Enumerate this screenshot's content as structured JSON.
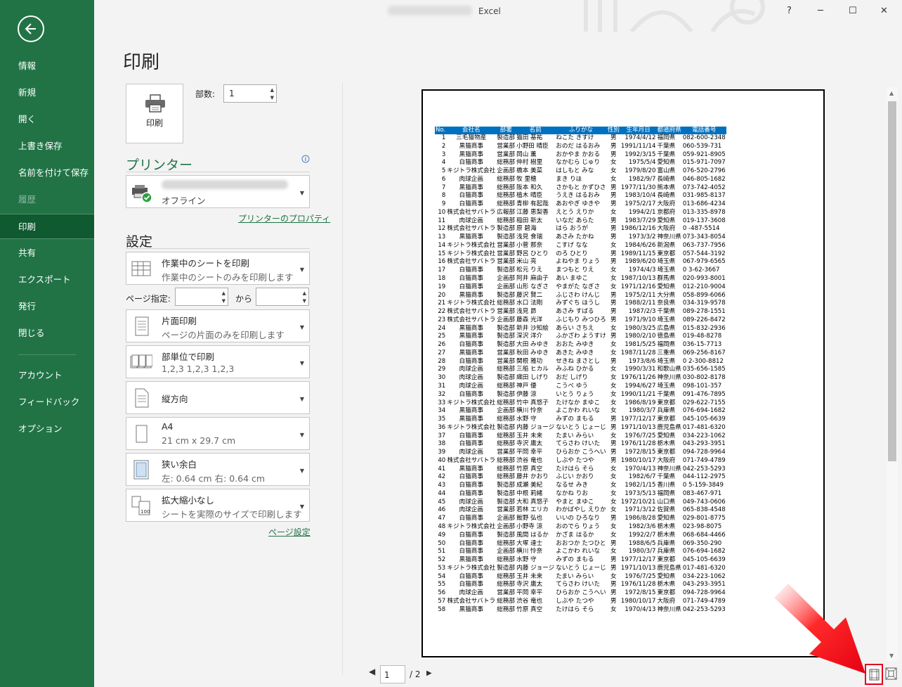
{
  "window": {
    "app_name": "Excel",
    "help": "?",
    "minimize": "─",
    "maximize": "☐",
    "close": "✕"
  },
  "sidebar": {
    "items": [
      {
        "label": "情報"
      },
      {
        "label": "新規"
      },
      {
        "label": "開く"
      },
      {
        "label": "上書き保存"
      },
      {
        "label": "名前を付けて保存"
      },
      {
        "label": "履歴"
      },
      {
        "label": "印刷"
      },
      {
        "label": "共有"
      },
      {
        "label": "エクスポート"
      },
      {
        "label": "発行"
      },
      {
        "label": "閉じる"
      }
    ],
    "bottom_items": [
      {
        "label": "アカウント"
      },
      {
        "label": "フィードバック"
      },
      {
        "label": "オプション"
      }
    ]
  },
  "print": {
    "title": "印刷",
    "print_button": "印刷",
    "copies_label": "部数:",
    "copies_value": "1",
    "printer_heading": "プリンター",
    "printer_status": "オフライン",
    "printer_properties": "プリンターのプロパティ",
    "settings_heading": "設定",
    "pages_label": "ページ指定:",
    "pages_to": "から",
    "page_setup": "ページ設定",
    "settings": [
      {
        "t1": "作業中のシートを印刷",
        "t2": "作業中のシートのみを印刷します"
      },
      {
        "t1": "片面印刷",
        "t2": "ページの片面のみを印刷します"
      },
      {
        "t1": "部単位で印刷",
        "t2": "1,2,3    1,2,3    1,2,3"
      },
      {
        "t1": "縦方向",
        "t2": ""
      },
      {
        "t1": "A4",
        "t2": "21 cm x 29.7 cm"
      },
      {
        "t1": "狭い余白",
        "t2": "左:  0.64 cm    右:  0.64 cm"
      },
      {
        "t1": "拡大縮小なし",
        "t2": "シートを実際のサイズで印刷します"
      }
    ]
  },
  "preview": {
    "page_current": "1",
    "page_total": "/ 2",
    "headers": [
      "No.",
      "会社名",
      "部署",
      "名前",
      "ふりがな",
      "性別",
      "生年月日",
      "都道府県",
      "電話番号"
    ],
    "rows": [
      [
        "1",
        "三毛猫物産",
        "製造部",
        "猫田 基祐",
        "ねこた きすけ",
        "男",
        "1974/4/12",
        "福岡県",
        "082-600-2348"
      ],
      [
        "2",
        "黒猫商事",
        "営業部",
        "小野田 晴臣",
        "おのだ はるおみ",
        "男",
        "1991/11/14",
        "千葉県",
        "060-539-731"
      ],
      [
        "3",
        "黒猫商事",
        "営業部",
        "岡山 薫",
        "おかやま かおる",
        "男",
        "1992/3/15",
        "千葉県",
        "059-921-8905"
      ],
      [
        "4",
        "白猫商事",
        "総務部",
        "仲村 樹里",
        "なかむら じゅり",
        "女",
        "1975/5/4",
        "愛知県",
        "015-971-7097"
      ],
      [
        "5",
        "キジトラ株式会社",
        "企画部",
        "橋本 美菜",
        "はしもと みな",
        "女",
        "1979/8/20",
        "富山県",
        "076-520-2796"
      ],
      [
        "6",
        "肉球企画",
        "総務部",
        "牧 里穂",
        "まき りほ",
        "女",
        "1982/9/7",
        "長崎県",
        "046-805-1682"
      ],
      [
        "7",
        "黒猫商事",
        "総務部",
        "阪本 和久",
        "さかもと かずひさ",
        "男",
        "1977/11/30",
        "熊本県",
        "073-742-4052"
      ],
      [
        "8",
        "白猫商事",
        "総務部",
        "植木 晴臣",
        "うえき はるおみ",
        "男",
        "1983/10/4",
        "長崎県",
        "031-985-8137"
      ],
      [
        "9",
        "白猫商事",
        "総務部",
        "青柳 有起哉",
        "あおやぎ ゆきや",
        "男",
        "1975/2/17",
        "大阪府",
        "013-686-4234"
      ],
      [
        "10",
        "株式会社サバトラ",
        "広報部",
        "江藤 恵梨香",
        "えとう えりか",
        "女",
        "1994/2/1",
        "京都府",
        "013-335-8978"
      ],
      [
        "11",
        "肉球企画",
        "総務部",
        "稲田 新太",
        "いなだ あらた",
        "男",
        "1983/7/29",
        "愛知県",
        "019-137-3608"
      ],
      [
        "12",
        "株式会社サバトラ",
        "製造部",
        "原 碧海",
        "はら おうが",
        "男",
        "1986/12/16",
        "大阪府",
        "0 -487-5514"
      ],
      [
        "13",
        "黒猫商事",
        "製造部",
        "浅見 食瑞",
        "あさみ たかね",
        "男",
        "1973/3/2",
        "神奈川県",
        "073-343-8054"
      ],
      [
        "14",
        "キジトラ株式会社",
        "営業部",
        "小菅 那奈",
        "こすげ なな",
        "女",
        "1984/6/26",
        "新潟県",
        "063-737-7956"
      ],
      [
        "15",
        "キジトラ株式会社",
        "営業部",
        "野呂 ひとり",
        "のろ ひとり",
        "男",
        "1989/11/15",
        "東京都",
        "057-544-3192"
      ],
      [
        "16",
        "株式会社サバトラ",
        "営業部",
        "米山 亮",
        "よねやま りょう",
        "男",
        "1989/6/20",
        "埼玉県",
        "067-979-6565"
      ],
      [
        "17",
        "白猫商事",
        "製造部",
        "松元 りえ",
        "まつもと りえ",
        "女",
        "1974/4/3",
        "埼玉県",
        "0 3-62-3667"
      ],
      [
        "18",
        "白猫商事",
        "企画部",
        "阿井 麻由子",
        "あい まゆこ",
        "女",
        "1987/10/13",
        "群馬県",
        "020-993-8001"
      ],
      [
        "19",
        "白猫商事",
        "企画部",
        "山形 なぎさ",
        "やまがた なぎさ",
        "女",
        "1971/12/16",
        "愛知県",
        "012-210-9004"
      ],
      [
        "20",
        "黒猫商事",
        "製造部",
        "藤沢 賢二",
        "ふじさわ けんじ",
        "男",
        "1975/2/11",
        "大分県",
        "058-899-6066"
      ],
      [
        "21",
        "キジトラ株式会社",
        "総務部",
        "水口 法剛",
        "みずぐち ほうし",
        "男",
        "1988/2/11",
        "奈良県",
        "034-319-9578"
      ],
      [
        "22",
        "株式会社サバトラ",
        "営業部",
        "浅見 昴",
        "あさみ すばる",
        "男",
        "1987/2/3",
        "千葉県",
        "089-278-1551"
      ],
      [
        "23",
        "株式会社サバトラ",
        "企画部",
        "藤森 光洋",
        "ふじもり みつひろ",
        "男",
        "1971/9/10",
        "埼玉県",
        "089-226-8472"
      ],
      [
        "24",
        "黒猫商事",
        "製造部",
        "新井 沙知絵",
        "あらい さちえ",
        "女",
        "1980/3/25",
        "広島県",
        "015-832-2936"
      ],
      [
        "25",
        "黒猫商事",
        "製造部",
        "深沢 洋介",
        "ふかざわ ようすけ",
        "男",
        "1980/2/10",
        "徳島県",
        "019-48-8278"
      ],
      [
        "26",
        "白猫商事",
        "製造部",
        "大田 みゆき",
        "おおた みゆき",
        "女",
        "1981/5/25",
        "福岡県",
        "036-15-7713"
      ],
      [
        "27",
        "黒猫商事",
        "営業部",
        "秋田 みゆき",
        "あきた みゆき",
        "女",
        "1987/11/28",
        "三重県",
        "069-256-8167"
      ],
      [
        "28",
        "白猫商事",
        "営業部",
        "関根 雅功",
        "せきね まさとし",
        "男",
        "1973/8/6",
        "埼玉県",
        "0 2-300-8812"
      ],
      [
        "29",
        "肉球企画",
        "総務部",
        "三船 ヒカル",
        "みふね ひかる",
        "女",
        "1990/3/31",
        "和歌山県",
        "035-656-1585"
      ],
      [
        "30",
        "肉球企画",
        "製造部",
        "織田 しげり",
        "おだ しげり",
        "女",
        "1976/11/26",
        "神奈川県",
        "030-802-8178"
      ],
      [
        "31",
        "肉球企画",
        "総務部",
        "神戸 優",
        "こうべ ゆう",
        "女",
        "1994/6/27",
        "埼玉県",
        "098-101-357"
      ],
      [
        "32",
        "白猫商事",
        "製造部",
        "伊藤 涼",
        "いとう りょう",
        "女",
        "1990/11/21",
        "千葉県",
        "091-476-7895"
      ],
      [
        "33",
        "キジトラ株式会社",
        "総務部",
        "竹中 真悠子",
        "たけなか まゆこ",
        "女",
        "1986/8/19",
        "東京都",
        "029-622-7155"
      ],
      [
        "34",
        "黒猫商事",
        "企画部",
        "横川 怜奈",
        "よこかわ れいな",
        "女",
        "1980/3/7",
        "兵庫県",
        "076-694-1682"
      ],
      [
        "35",
        "黒猫商事",
        "総務部",
        "水野 守",
        "みずの まもる",
        "男",
        "1977/12/17",
        "東京都",
        "045-105-6639"
      ],
      [
        "36",
        "キジトラ株式会社",
        "製造部",
        "内藤 ジョージ",
        "ないとう じょーじ",
        "男",
        "1971/10/13",
        "鹿児島県",
        "017-481-6320"
      ],
      [
        "37",
        "白猫商事",
        "総務部",
        "玉井 未来",
        "たまい みらい",
        "女",
        "1976/7/25",
        "愛知県",
        "034-223-1062"
      ],
      [
        "38",
        "白猫商事",
        "総務部",
        "寺沢 庸太",
        "てらさわ けいた",
        "男",
        "1976/11/28",
        "栃木県",
        "043-293-3951"
      ],
      [
        "39",
        "肉球企画",
        "営業部",
        "平岡 幸平",
        "ひらおか こうへい",
        "男",
        "1972/8/15",
        "東京都",
        "094-728-9964"
      ],
      [
        "40",
        "株式会社サバトラ",
        "総務部",
        "渋谷 竜也",
        "しぶや たつや",
        "男",
        "1980/10/17",
        "大阪府",
        "071-749-4789"
      ],
      [
        "41",
        "黒猫商事",
        "総務部",
        "竹原 真空",
        "たけはら そら",
        "女",
        "1970/4/13",
        "神奈川県",
        "042-253-5293"
      ],
      [
        "42",
        "白猫商事",
        "総務部",
        "藤井 かおり",
        "ふじい かおり",
        "女",
        "1982/6/7",
        "千葉県",
        "044-112-2975"
      ],
      [
        "43",
        "白猫商事",
        "製造部",
        "成瀬 美紀",
        "なるせ みき",
        "女",
        "1982/1/15",
        "香川県",
        "0 5-159-3849"
      ],
      [
        "44",
        "白猫商事",
        "製造部",
        "中根 莉緒",
        "なかね りお",
        "女",
        "1973/5/13",
        "福岡県",
        "083-467-971"
      ],
      [
        "45",
        "肉球企画",
        "製造部",
        "大和 真悠子",
        "やまと まゆこ",
        "女",
        "1972/10/21",
        "山口県",
        "049-743-0606"
      ],
      [
        "46",
        "肉球企画",
        "営業部",
        "若林 エリカ",
        "わかばやし えりか",
        "女",
        "1971/3/12",
        "佐賀県",
        "065-838-4548"
      ],
      [
        "47",
        "白猫商事",
        "企画部",
        "飯野 弘也",
        "いいの ひろなり",
        "男",
        "1986/8/28",
        "愛知県",
        "029-801-8775"
      ],
      [
        "48",
        "キジトラ株式会社",
        "企画部",
        "小野寺 涼",
        "おのでら りょう",
        "女",
        "1982/3/6",
        "栃木県",
        "023-98-8075"
      ],
      [
        "49",
        "白猫商事",
        "製造部",
        "風間 はるか",
        "かざま はるか",
        "女",
        "1992/2/7",
        "栃木県",
        "068-684-4466"
      ],
      [
        "50",
        "白猫商事",
        "総務部",
        "大塚 達士",
        "おおつか たつひと",
        "男",
        "1988/6/5",
        "兵庫県",
        "069-350-290"
      ],
      [
        "51",
        "白猫商事",
        "企画部",
        "横川 怜奈",
        "よこかわ れいな",
        "女",
        "1980/3/7",
        "兵庫県",
        "076-694-1682"
      ],
      [
        "52",
        "黒猫商事",
        "総務部",
        "水野 守",
        "みずの まもる",
        "男",
        "1977/12/17",
        "東京都",
        "045-105-6639"
      ],
      [
        "53",
        "キジトラ株式会社",
        "製造部",
        "内藤 ジョージ",
        "ないとう じょーじ",
        "男",
        "1971/10/13",
        "鹿児島県",
        "017-481-6320"
      ],
      [
        "54",
        "白猫商事",
        "総務部",
        "玉井 未来",
        "たまい みらい",
        "女",
        "1976/7/25",
        "愛知県",
        "034-223-1062"
      ],
      [
        "55",
        "白猫商事",
        "総務部",
        "寺沢 庸太",
        "てらさわ けいた",
        "男",
        "1976/11/28",
        "栃木県",
        "043-293-3951"
      ],
      [
        "56",
        "肉球企画",
        "営業部",
        "平岡 幸平",
        "ひらおか こうへい",
        "男",
        "1972/8/15",
        "東京都",
        "094-728-9964"
      ],
      [
        "57",
        "株式会社サバトラ",
        "総務部",
        "渋谷 竜也",
        "しぶや たつや",
        "男",
        "1980/10/17",
        "大阪府",
        "071-749-4789"
      ],
      [
        "58",
        "黒猫商事",
        "総務部",
        "竹原 真空",
        "たけはら そら",
        "女",
        "1970/4/13",
        "神奈川県",
        "042-253-5293"
      ]
    ]
  },
  "colors": {
    "accent": "#217346",
    "header_blue": "#0070c0",
    "highlight_red": "#e3001b"
  },
  "icons": {
    "back": "back-arrow-icon",
    "show_margins": "show-margins-icon",
    "zoom_page": "zoom-to-page-icon"
  }
}
